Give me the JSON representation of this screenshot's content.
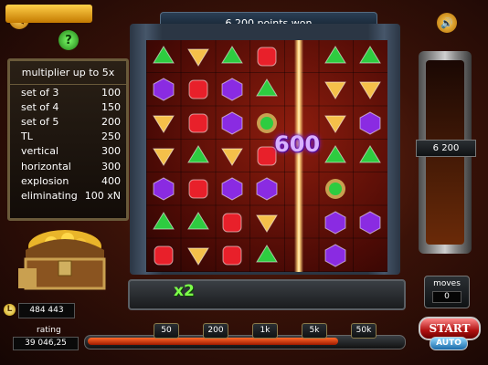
{
  "header": {
    "message": "6 200 points won"
  },
  "buttons": {
    "back_icon": "back-arrow-icon",
    "help_label": "?",
    "sound_icon": "speaker-icon"
  },
  "multiplier_table": {
    "title": "multiplier up to 5x",
    "rows": [
      {
        "label": "set of 3",
        "value": "100"
      },
      {
        "label": "set of 4",
        "value": "150"
      },
      {
        "label": "set of 5",
        "value": "200"
      },
      {
        "label": "TL",
        "value": "250"
      },
      {
        "label": "vertical",
        "value": "300"
      },
      {
        "label": "horizontal",
        "value": "300"
      },
      {
        "label": "explosion",
        "value": "400"
      },
      {
        "label": "eliminating",
        "value": "100 xN"
      }
    ]
  },
  "board": {
    "popup_score": "600",
    "grid": [
      [
        "green",
        "yellow",
        "green",
        "red",
        "beam",
        "green",
        "green"
      ],
      [
        "purple",
        "red",
        "purple",
        "green",
        "beam",
        "yellow",
        "yellow"
      ],
      [
        "yellow",
        "red",
        "purple",
        "bomb",
        "beam",
        "yellow",
        "purple"
      ],
      [
        "yellow",
        "green",
        "yellow",
        "red",
        "beam",
        "green",
        "green"
      ],
      [
        "purple",
        "red",
        "purple",
        "purple",
        "beam",
        "bomb",
        "empty"
      ],
      [
        "green",
        "green",
        "red",
        "yellow",
        "beam",
        "purple",
        "purple"
      ],
      [
        "red",
        "yellow",
        "red",
        "green",
        "beam",
        "purple",
        "empty"
      ]
    ],
    "colors": {
      "green": "#2ecc40",
      "yellow": "#f5c04a",
      "red": "#e8202a",
      "purple": "#8a2be2",
      "bomb": "#2ecc40"
    }
  },
  "progress": {
    "multiplier": "x2",
    "fill_fraction": 0.33
  },
  "score_column": {
    "score": "6 200"
  },
  "moves": {
    "label": "moves",
    "value": "0"
  },
  "coins": {
    "icon_letter": "L",
    "value": "484 443"
  },
  "rating": {
    "label": "rating",
    "value": "39 046,25"
  },
  "bets": {
    "options": [
      "50",
      "200",
      "1k",
      "5k",
      "50k"
    ],
    "fill_fraction": 0.8
  },
  "controls": {
    "start_label": "START",
    "auto_label": "AUTO"
  }
}
